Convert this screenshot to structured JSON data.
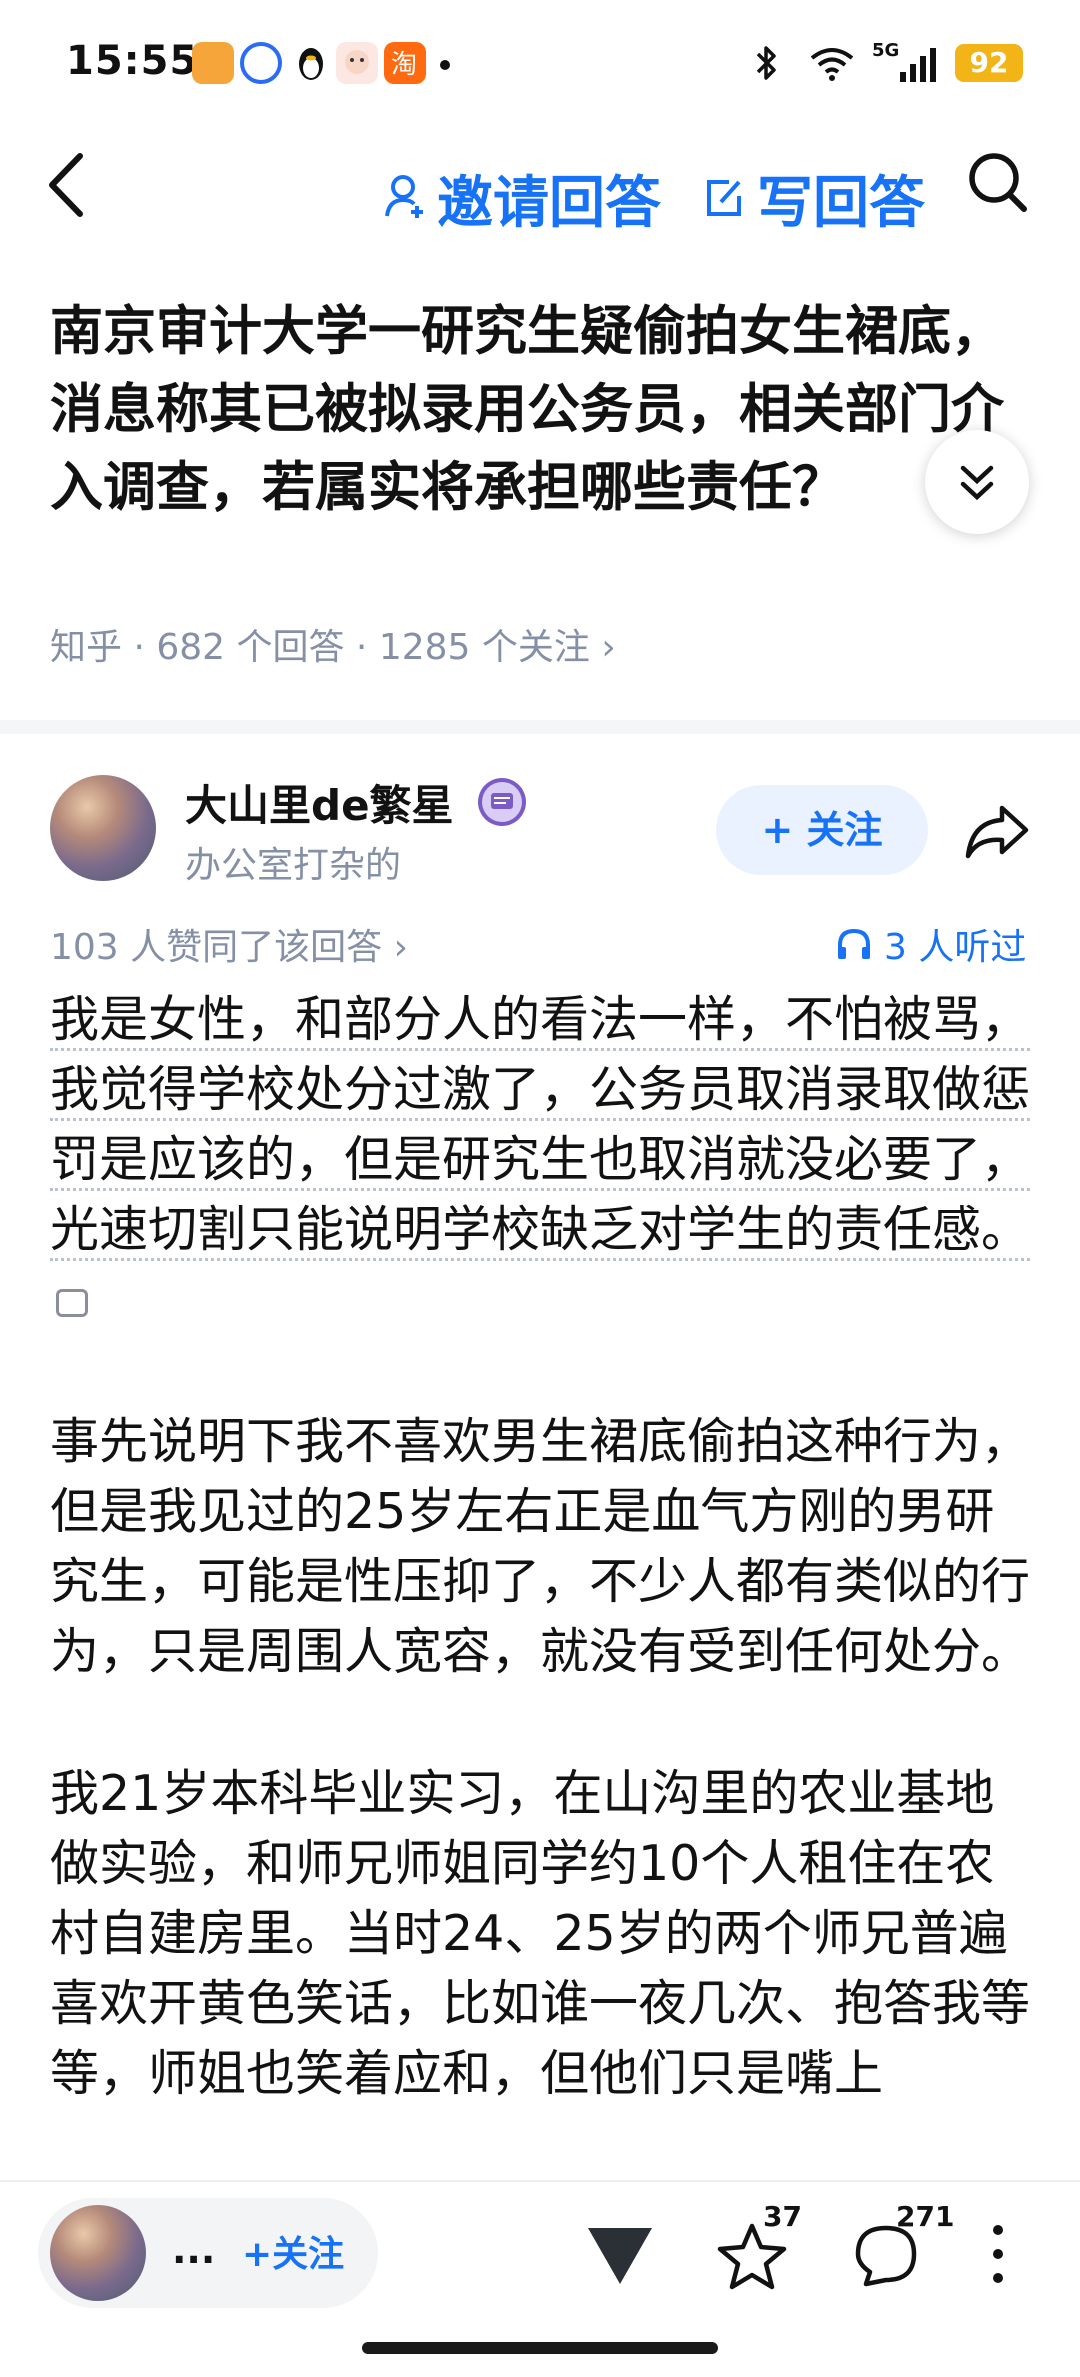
{
  "status_bar": {
    "time": "15:55",
    "network": "5G",
    "battery": "92",
    "icons": [
      "app-icon-orange",
      "app-icon-blue",
      "qq-penguin-icon",
      "app-icon-avatar",
      "taobao-icon"
    ]
  },
  "nav": {
    "invite_label": "邀请回答",
    "write_label": "写回答"
  },
  "question": {
    "title": "南京审计大学一研究生疑偷拍女生裙底，消息称其已被拟录用公务员，相关部门介入调查，若属实将承担哪些责任？",
    "meta": "知乎 · 682 个回答 · 1285 个关注 ›"
  },
  "author": {
    "name": "大山里de繁星",
    "bio": "办公室打杂的",
    "follow_label": "+ 关注"
  },
  "answer": {
    "votes": "103 人赞同了该回答 ›",
    "listened": "3 人听过",
    "paragraphs": [
      "我是女性，和部分人的看法一样，不怕被骂，我觉得学校处分过激了，公务员取消录取做惩罚是应该的，但是研究生也取消就没必要了，光速切割只能说明学校缺乏对学生的责任感。",
      "事先说明下我不喜欢男生裙底偷拍这种行为，但是我见过的25岁左右正是血气方刚的男研究生，可能是性压抑了，不少人都有类似的行为，只是周围人宽容，就没有受到任何处分。",
      "我21岁本科毕业实习，在山沟里的农业基地做实验，和师兄师姐同学约10个人租住在农村自建房里。当时24、25岁的两个师兄普遍喜欢开黄色笑话，比如谁一夜几次、抱答我等等，师姐也笑着应和，但他们只是嘴上"
    ]
  },
  "bottom_bar": {
    "author_short": "...",
    "follow_label": "+关注",
    "star_count": "37",
    "comment_count": "271"
  },
  "colors": {
    "accent": "#1772f6",
    "muted": "#8590a6",
    "battery": "#f2b417"
  }
}
